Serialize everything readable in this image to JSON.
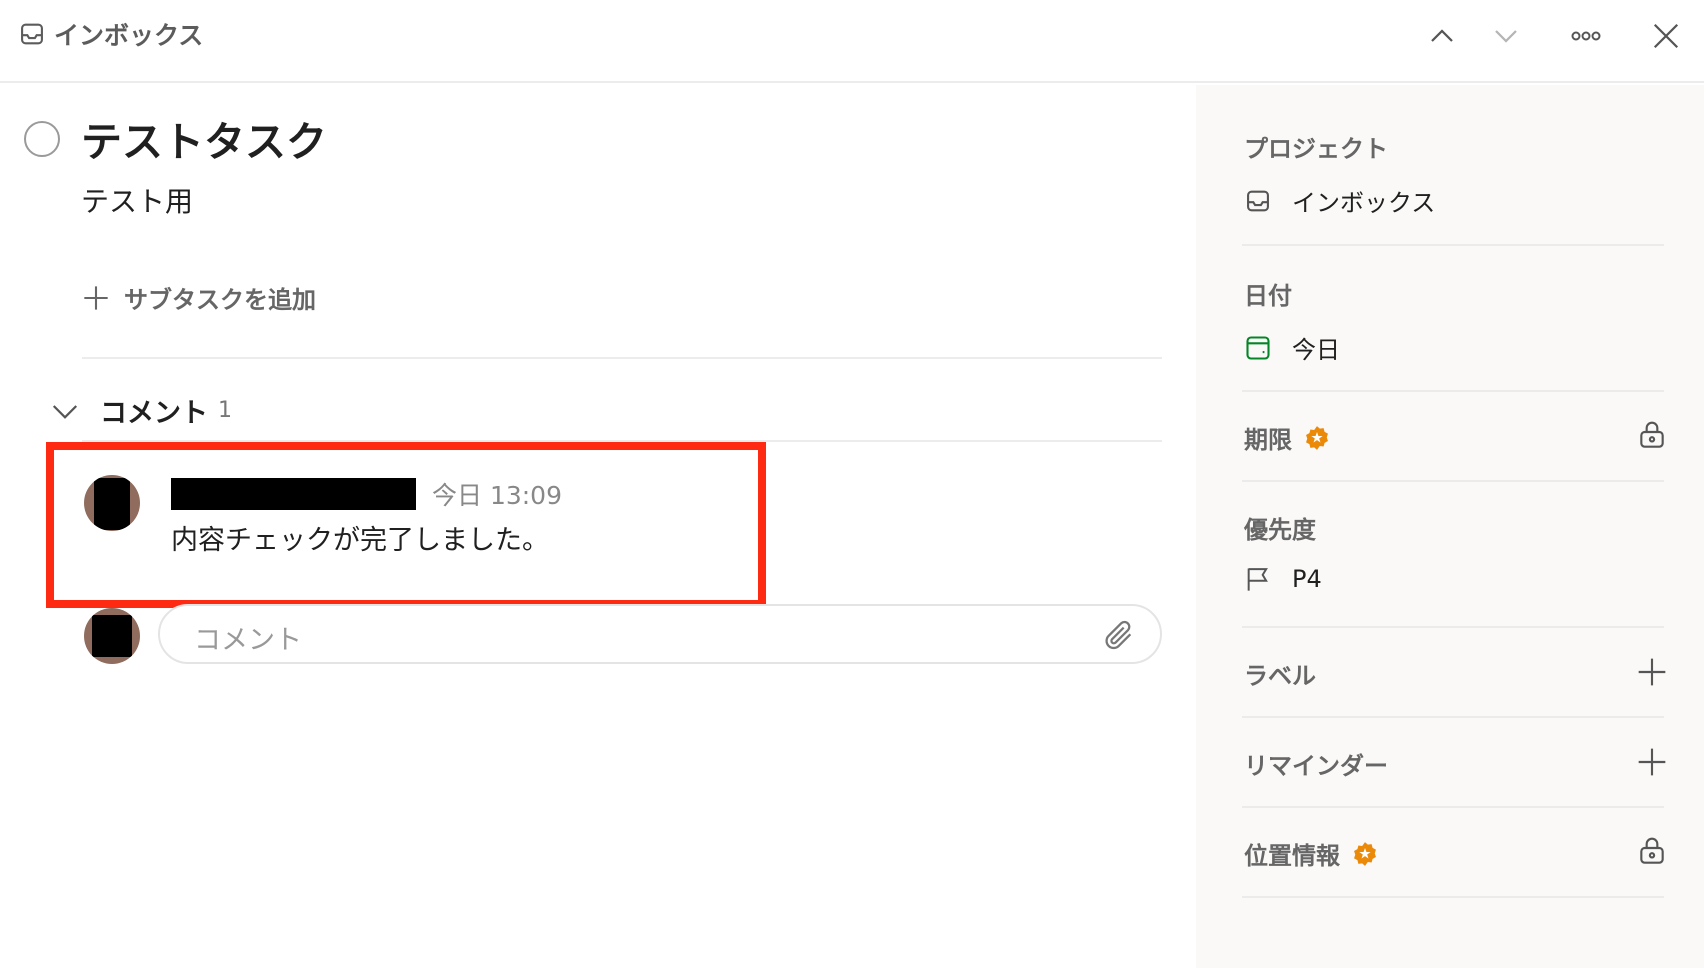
{
  "header": {
    "breadcrumb": "インボックス",
    "icons": [
      "inbox-icon",
      "chevron-up-icon",
      "chevron-down-icon",
      "more-icon",
      "close-icon"
    ]
  },
  "task": {
    "title": "テストタスク",
    "description": "テスト用",
    "add_subtask": "サブタスクを追加"
  },
  "comments": {
    "label": "コメント",
    "count": "1",
    "items": [
      {
        "time": "今日 13:09",
        "text": "内容チェックが完了しました。"
      }
    ],
    "input_placeholder": "コメント"
  },
  "sidebar": {
    "project_label": "プロジェクト",
    "project_value": "インボックス",
    "date_label": "日付",
    "date_value": "今日",
    "deadline_label": "期限",
    "priority_label": "優先度",
    "priority_value": "P4",
    "labels_label": "ラベル",
    "reminders_label": "リマインダー",
    "location_label": "位置情報"
  },
  "colors": {
    "accent_red": "#ff2a12",
    "pro_badge": "#eb8909",
    "date_green": "#058527",
    "avatar": "#8f6c5d"
  }
}
